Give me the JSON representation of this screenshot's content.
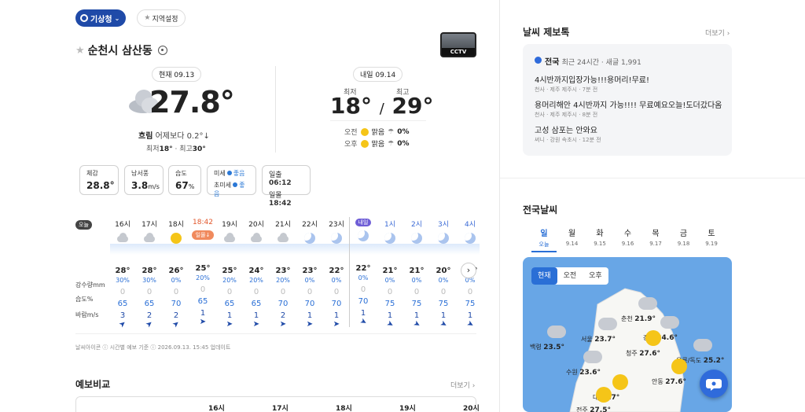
{
  "top": {
    "agency": "기상청",
    "region_setting": "지역설정"
  },
  "location": {
    "name": "순천시 삼산동",
    "cctv_label": "CCTV"
  },
  "current": {
    "tag": "현재 09.13",
    "temp": "27.8°",
    "condition": "흐림",
    "compare": "어제보다 0.2°↓",
    "minmax_prefix1": "최저",
    "min": "18°",
    "minmax_prefix2": "최고",
    "max": "30°"
  },
  "tomorrow": {
    "tag": "내일 09.14",
    "min_label": "최저",
    "max_label": "최고",
    "min": "18°",
    "sep": "/",
    "max": "29°",
    "am_label": "오전",
    "pm_label": "오후",
    "am_cond": "맑음",
    "pm_cond": "맑음",
    "am_pop": "0%",
    "pm_pop": "0%"
  },
  "metrics": [
    {
      "label": "체감",
      "value": "28.8°",
      "unit": ""
    },
    {
      "label": "남서풍",
      "value": "3.8",
      "unit": "m/s"
    },
    {
      "label": "습도",
      "value": "67",
      "unit": "%"
    }
  ],
  "dust": {
    "pm10_label": "미세",
    "pm10": "좋음",
    "pm25_label": "초미세",
    "pm25": "좋음"
  },
  "sun": {
    "rise_label": "일출",
    "rise": "06:12",
    "set_label": "일몰",
    "set": "18:42"
  },
  "hourly": {
    "today_badge": "오늘",
    "tomorrow_badge": "내일",
    "row_labels": {
      "precip": "강수량mm",
      "humid": "습도%",
      "wind": "바람m/s"
    },
    "hours": [
      {
        "time": "16시",
        "icon": "cloud",
        "temp": "28°",
        "pop": "30%",
        "precip": "0",
        "humid": "65",
        "wind": "3"
      },
      {
        "time": "17시",
        "icon": "cloud",
        "temp": "28°",
        "pop": "30%",
        "precip": "0",
        "humid": "65",
        "wind": "2"
      },
      {
        "time": "18시",
        "icon": "sun",
        "temp": "26°",
        "pop": "0%",
        "precip": "0",
        "humid": "70",
        "wind": "2"
      },
      {
        "time": "18:42",
        "icon": "sunset",
        "badge": "일몰↓",
        "temp": "25°",
        "pop": "20%",
        "precip": "0",
        "humid": "65",
        "wind": "1"
      },
      {
        "time": "19시",
        "icon": "cloud",
        "temp": "25°",
        "pop": "20%",
        "precip": "0",
        "humid": "65",
        "wind": "1"
      },
      {
        "time": "20시",
        "icon": "cloud",
        "temp": "24°",
        "pop": "20%",
        "precip": "0",
        "humid": "65",
        "wind": "1"
      },
      {
        "time": "21시",
        "icon": "cloud",
        "temp": "23°",
        "pop": "20%",
        "precip": "0",
        "humid": "70",
        "wind": "2"
      },
      {
        "time": "22시",
        "icon": "moon",
        "temp": "23°",
        "pop": "0%",
        "precip": "0",
        "humid": "70",
        "wind": "1"
      },
      {
        "time": "23시",
        "icon": "moon",
        "temp": "22°",
        "pop": "0%",
        "precip": "0",
        "humid": "70",
        "wind": "1"
      },
      {
        "time": "내일",
        "icon": "moon",
        "temp": "22°",
        "pop": "0%",
        "precip": "0",
        "humid": "70",
        "wind": "1"
      },
      {
        "time": "1시",
        "icon": "moon",
        "temp": "21°",
        "pop": "0%",
        "precip": "0",
        "humid": "75",
        "wind": "1"
      },
      {
        "time": "2시",
        "icon": "moon",
        "temp": "21°",
        "pop": "0%",
        "precip": "0",
        "humid": "75",
        "wind": "1"
      },
      {
        "time": "3시",
        "icon": "moon",
        "temp": "20°",
        "pop": "0%",
        "precip": "0",
        "humid": "75",
        "wind": "1"
      },
      {
        "time": "4시",
        "icon": "moon",
        "temp": "20°",
        "pop": "0%",
        "precip": "0",
        "humid": "75",
        "wind": "1"
      }
    ],
    "footer": "날씨아이콘 ⓘ   시간별 예보 기준 ⓘ   2026.09.13. 15:45 업데이트"
  },
  "compare": {
    "title": "예보비교",
    "more": "더보기 ›",
    "hours": [
      "16시",
      "17시",
      "18시",
      "19시",
      "20시"
    ]
  },
  "report": {
    "title": "날씨 제보톡",
    "more": "더보기 ›",
    "region": "전국",
    "summary": "최근 24시간 · 새글 1,991",
    "posts": [
      {
        "text": "4시반까지입장가능!!!용머리!무료!",
        "meta": "천사 · 제주 제주시 · 7분 전"
      },
      {
        "text": "용머리해안 4시반까지 가능!!!! 무료예요오늘!도더갔다옴 ...",
        "meta": "천사 · 제주 제주시 · 8분 전"
      },
      {
        "text": "고성 삼포는 안와요",
        "meta": "써니 · 강원 속초시 · 12분 전"
      }
    ]
  },
  "national": {
    "title": "전국날씨",
    "days": [
      {
        "d": "일",
        "date": "오늘"
      },
      {
        "d": "월",
        "date": "9.14"
      },
      {
        "d": "화",
        "date": "9.15"
      },
      {
        "d": "수",
        "date": "9.16"
      },
      {
        "d": "목",
        "date": "9.17"
      },
      {
        "d": "금",
        "date": "9.18"
      },
      {
        "d": "토",
        "date": "9.19"
      }
    ],
    "segments": [
      "현재",
      "오전",
      "오후"
    ],
    "cities": [
      {
        "name": "춘천",
        "temp": "21.9°"
      },
      {
        "name": "서울",
        "temp": "23.7°"
      },
      {
        "name": "강릉",
        "temp": "24.6°"
      },
      {
        "name": "백령",
        "temp": "23.5°"
      },
      {
        "name": "청주",
        "temp": "27.6°"
      },
      {
        "name": "울릉/독도",
        "temp": "25.2°"
      },
      {
        "name": "수원",
        "temp": "23.6°"
      },
      {
        "name": "안동",
        "temp": "27.6°"
      },
      {
        "name": "대전",
        "temp": "27°"
      },
      {
        "name": "전주",
        "temp": "27.5°"
      }
    ]
  }
}
